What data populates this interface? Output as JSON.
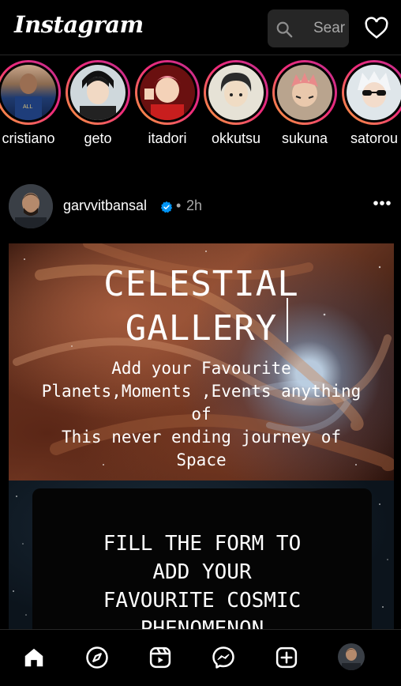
{
  "header": {
    "logo": "Instagram",
    "search_placeholder": "Search"
  },
  "stories": [
    {
      "username": "cristiano"
    },
    {
      "username": "geto"
    },
    {
      "username": "itadori"
    },
    {
      "username": "okkutsu"
    },
    {
      "username": "sukuna"
    },
    {
      "username": "satorou"
    }
  ],
  "post": {
    "username": "garvvitbansal",
    "separator": "•",
    "time_ago": "2h",
    "media": {
      "title_line1": "CELESTIAL",
      "title_line2": "GALLERY",
      "subtitle_line1": "Add your Favourite",
      "subtitle_line2": "Planets,Moments ,Events anything",
      "subtitle_line3": "of",
      "subtitle_line4": "This never ending journey of",
      "subtitle_line5": "Space"
    },
    "form": {
      "line1": "FILL THE FORM TO",
      "line2": "ADD YOUR",
      "line3": "FAVOURITE COSMIC",
      "line4": "PHENOMENON"
    }
  },
  "colors": {
    "background": "#000000",
    "story_ring_start": "#f9a13b",
    "story_ring_end": "#c02f8e",
    "verified": "#0095f6",
    "muted_text": "#a8a8a8",
    "search_bg": "#262626"
  },
  "icons": {
    "header": [
      "search-icon",
      "heart-icon"
    ],
    "post": [
      "verified-badge-icon",
      "more-options-icon"
    ],
    "bottom_nav": [
      "home-icon",
      "explore-compass-icon",
      "reels-icon",
      "messenger-icon",
      "create-plus-icon",
      "profile-avatar"
    ]
  }
}
